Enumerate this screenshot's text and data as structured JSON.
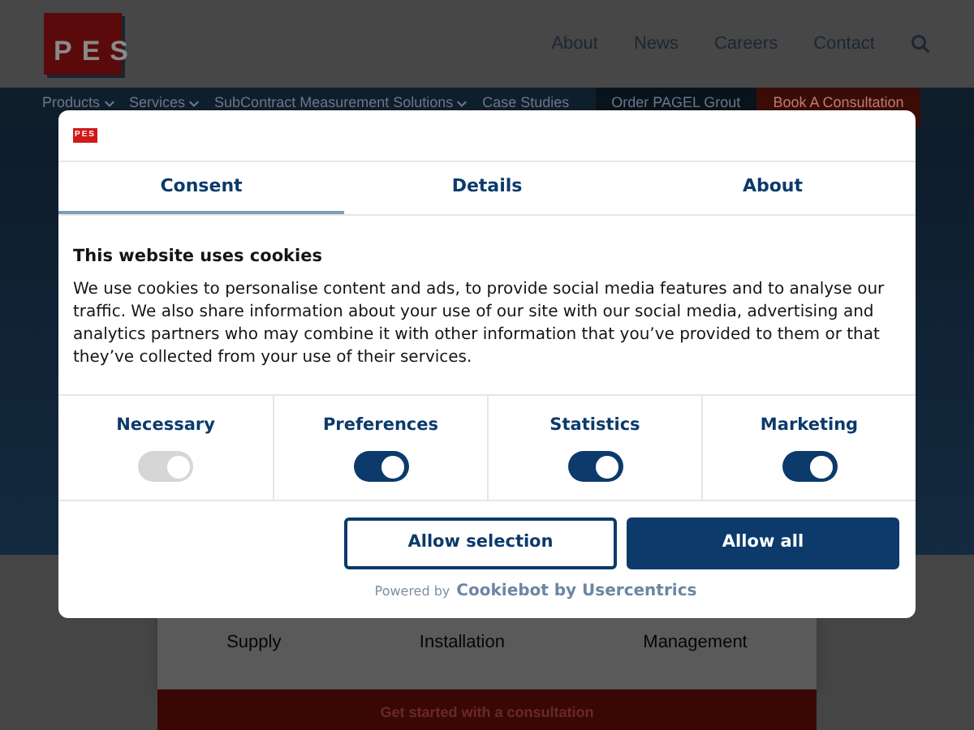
{
  "header": {
    "logo": "PES",
    "links": [
      "About",
      "News",
      "Careers",
      "Contact"
    ]
  },
  "nav": {
    "items": [
      {
        "label": "Products",
        "dropdown": true
      },
      {
        "label": "Services",
        "dropdown": true
      },
      {
        "label": "SubContract Measurement Solutions",
        "dropdown": true
      },
      {
        "label": "Case Studies",
        "dropdown": false
      }
    ],
    "order_button": "Order PAGEL Grout",
    "consult_button": "Book A Consultation"
  },
  "services": [
    "Supply",
    "Installation",
    "Management"
  ],
  "cta": "Get started with a consultation",
  "cookie_dialog": {
    "logo": "PES",
    "tabs": [
      {
        "label": "Consent",
        "selected": true
      },
      {
        "label": "Details",
        "selected": false
      },
      {
        "label": "About",
        "selected": false
      }
    ],
    "heading": "This website uses cookies",
    "body": "We use cookies to personalise content and ads, to provide social media features and to analyse our traffic. We also share information about your use of our site with our social media, advertising and analytics partners who may combine it with other information that you’ve provided to them or that they’ve collected from your use of their services.",
    "categories": [
      {
        "label": "Necessary",
        "on": true,
        "disabled": true
      },
      {
        "label": "Preferences",
        "on": true,
        "disabled": false
      },
      {
        "label": "Statistics",
        "on": true,
        "disabled": false
      },
      {
        "label": "Marketing",
        "on": true,
        "disabled": false
      }
    ],
    "buttons": [
      {
        "label": "Allow selection",
        "kind": "outline"
      },
      {
        "label": "Allow all",
        "kind": "primary"
      }
    ],
    "powered_by": "Powered by",
    "powered_brand": "Cookiebot by Usercentrics"
  }
}
